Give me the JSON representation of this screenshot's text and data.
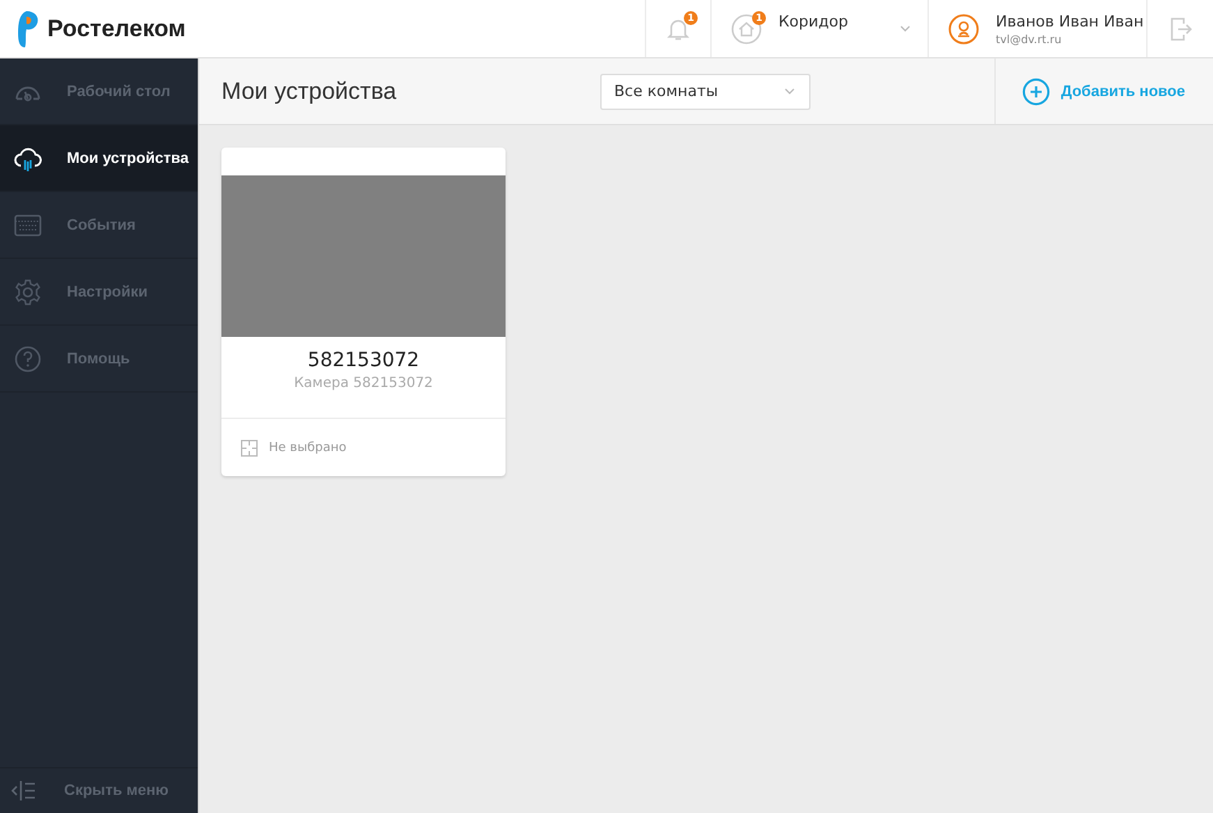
{
  "header": {
    "brand": "Ростелеком",
    "notifications": {
      "badge": "1"
    },
    "location": {
      "badge": "1",
      "name": "Коридор"
    },
    "user": {
      "name": "Иванов Иван Иван",
      "email": "tvl@dv.rt.ru"
    }
  },
  "sidebar": {
    "items": [
      {
        "label": "Рабочий стол",
        "selected": false
      },
      {
        "label": "Мои устройства",
        "selected": true
      },
      {
        "label": "События",
        "selected": false
      },
      {
        "label": "Настройки",
        "selected": false
      },
      {
        "label": "Помощь",
        "selected": false
      }
    ],
    "collapse": "Скрыть меню"
  },
  "toolbar": {
    "title": "Мои устройства",
    "room_filter": "Все комнаты",
    "add_button": "Добавить новое"
  },
  "devices": [
    {
      "number": "582153072",
      "name": "Камера 582153072",
      "room": "Не выбрано"
    }
  ]
}
